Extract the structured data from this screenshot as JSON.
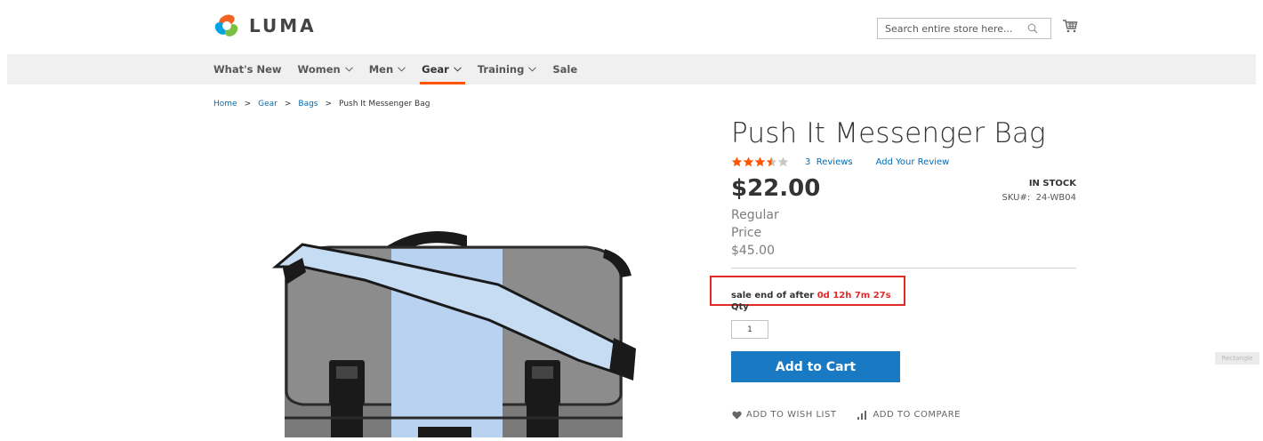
{
  "header": {
    "logo_text": "LUMA",
    "search_placeholder": "Search entire store here...",
    "cart_icon": "cart-icon",
    "search_icon": "search-icon"
  },
  "nav": {
    "items": [
      {
        "label": "What's New",
        "has_dropdown": false
      },
      {
        "label": "Women",
        "has_dropdown": true
      },
      {
        "label": "Men",
        "has_dropdown": true
      },
      {
        "label": "Gear",
        "has_dropdown": true,
        "active": true
      },
      {
        "label": "Training",
        "has_dropdown": true
      },
      {
        "label": "Sale",
        "has_dropdown": false
      }
    ]
  },
  "breadcrumb": {
    "items": [
      "Home",
      "Gear",
      "Bags"
    ],
    "current": "Push It Messenger Bag"
  },
  "product": {
    "title": "Push It Messenger Bag",
    "rating_stars": 3.5,
    "rating_max": 5,
    "reviews_label": "3  Reviews",
    "add_review_label": "Add Your Review",
    "price": "$22.00",
    "stock": "IN STOCK",
    "sku": "SKU#:  24-WB04",
    "regular_label_1": "Regular",
    "regular_label_2": "Price",
    "regular_price": "$45.00",
    "sale_prefix": "sale end of after ",
    "sale_countdown": "0d 12h 7m 27s",
    "qty_label": "Qty",
    "qty_value": "1",
    "add_to_cart": "Add to Cart",
    "wishlist_label": "ADD TO WISH LIST",
    "compare_label": "ADD TO COMPARE"
  },
  "overlay": {
    "rectangle_label": "Rectangle"
  },
  "colors": {
    "accent": "#ff5501",
    "link": "#006bb4",
    "primary_button": "#1979c3",
    "highlight_box": "#e02b27",
    "star": "#ff5501",
    "nav_bg": "#f0f0f0"
  }
}
